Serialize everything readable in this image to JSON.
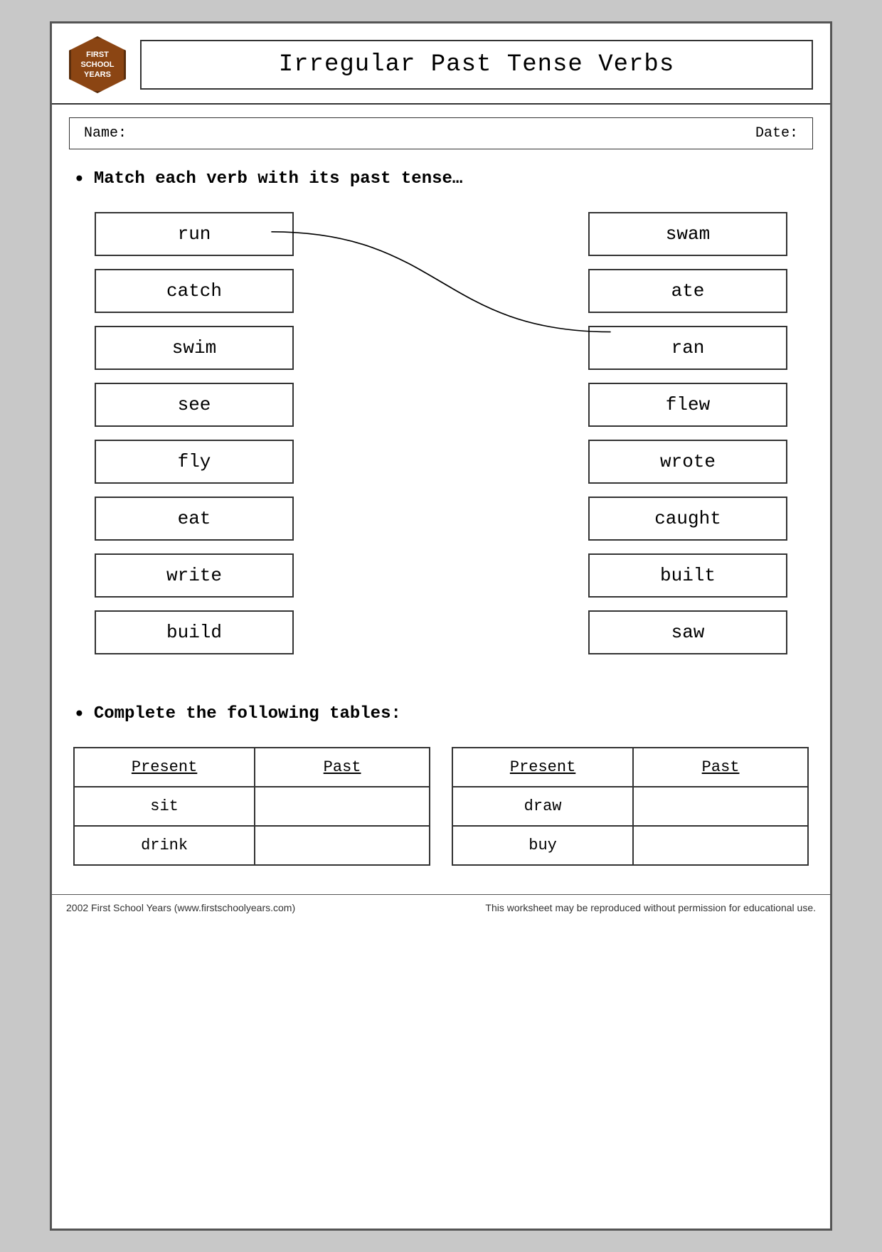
{
  "header": {
    "logo_line1": "FIRST",
    "logo_line2": "SCHOOL",
    "logo_line3": "YEARS",
    "title": "Irregular Past Tense Verbs"
  },
  "name_date": {
    "name_label": "Name:",
    "date_label": "Date:"
  },
  "section1": {
    "instruction": "Match each verb with its past tense…",
    "left_verbs": [
      "run",
      "catch",
      "swim",
      "see",
      "fly",
      "eat",
      "write",
      "build"
    ],
    "right_verbs": [
      "swam",
      "ate",
      "ran",
      "flew",
      "wrote",
      "caught",
      "built",
      "saw"
    ]
  },
  "section2": {
    "instruction": "Complete the following tables:",
    "table1": {
      "col1": "Present",
      "col2": "Past",
      "rows": [
        {
          "present": "sit",
          "past": ""
        },
        {
          "present": "drink",
          "past": ""
        }
      ]
    },
    "table2": {
      "col1": "Present",
      "col2": "Past",
      "rows": [
        {
          "present": "draw",
          "past": ""
        },
        {
          "present": "buy",
          "past": ""
        }
      ]
    }
  },
  "footer": {
    "left": "2002 First School Years  (www.firstschoolyears.com)",
    "right": "This worksheet may be reproduced without permission for educational use."
  }
}
